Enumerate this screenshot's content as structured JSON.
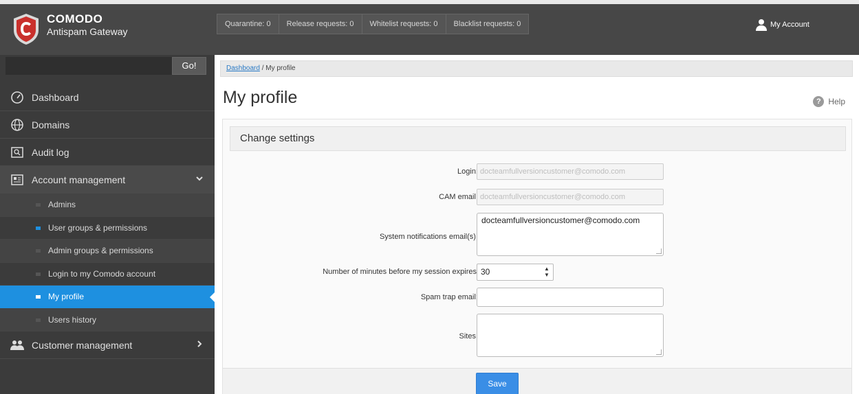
{
  "header": {
    "brand_top": "COMODO",
    "brand_bottom": "Antispam Gateway",
    "counters": [
      {
        "label": "Quarantine: 0"
      },
      {
        "label": "Release requests: 0"
      },
      {
        "label": "Whitelist requests: 0"
      },
      {
        "label": "Blacklist requests: 0"
      }
    ],
    "account_label": "My Account"
  },
  "sidebar": {
    "search_value": "",
    "go_label": "Go!",
    "items": [
      {
        "label": "Dashboard",
        "icon": "gauge-icon"
      },
      {
        "label": "Domains",
        "icon": "globe-icon"
      },
      {
        "label": "Audit log",
        "icon": "log-icon"
      },
      {
        "label": "Account management",
        "icon": "account-icon"
      },
      {
        "label": "Customer management",
        "icon": "users-icon"
      }
    ],
    "sub_items": [
      {
        "label": "Admins"
      },
      {
        "label": "User groups & permissions"
      },
      {
        "label": "Admin groups & permissions"
      },
      {
        "label": "Login to my Comodo account"
      },
      {
        "label": "My profile"
      },
      {
        "label": "Users history"
      }
    ]
  },
  "main": {
    "breadcrumb_link": "Dashboard",
    "breadcrumb_rest": " / My profile",
    "title": "My profile",
    "help_label": "Help",
    "panel_title": "Change settings",
    "fields": {
      "login_label": "Login:",
      "login_value": "docteamfullversioncustomer@comodo.com",
      "cam_label": "CAM email:",
      "cam_value": "docteamfullversioncustomer@comodo.com",
      "sysnotif_label": "System notifications email(s):",
      "sysnotif_value": "docteamfullversioncustomer@comodo.com",
      "session_label": "Number of minutes before my session expires",
      "session_value": "30",
      "spamtrap_label": "Spam trap email:",
      "spamtrap_value": "",
      "sites_label": "Sites:",
      "sites_value": ""
    },
    "save_label": "Save"
  },
  "colors": {
    "topbar": "#474747",
    "sidebar": "#3b3b3b",
    "active": "#1e90e0",
    "save_button": "#3a8ee6"
  }
}
